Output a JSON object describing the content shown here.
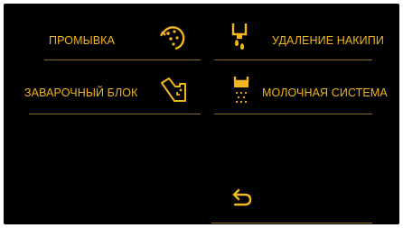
{
  "menu": {
    "items": [
      {
        "label": "ПРОМЫВКА",
        "icon": "rinse-icon"
      },
      {
        "label": "УДАЛЕНИЕ НАКИПИ",
        "icon": "descale-icon"
      },
      {
        "label": "ЗАВАРОЧНЫЙ БЛОК",
        "icon": "brew-unit-icon"
      },
      {
        "label": "МОЛОЧНАЯ СИСТЕМА",
        "icon": "milk-system-icon"
      }
    ]
  },
  "footer": {
    "back_icon": "back-arrow-icon"
  },
  "colors": {
    "accent": "#f2b61c",
    "background": "#000000",
    "divider": "#8a6a1c"
  }
}
